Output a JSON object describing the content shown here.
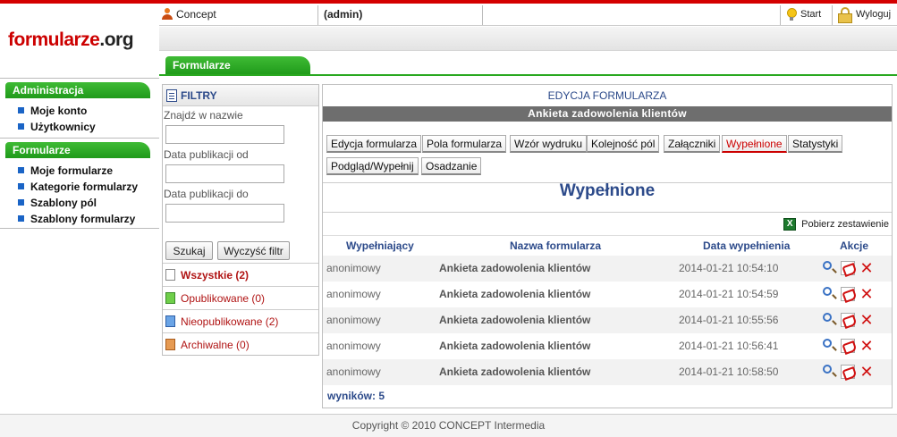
{
  "logo": {
    "part1": "formularze",
    "part2": ".org"
  },
  "topbar": {
    "user": "Concept",
    "role": "(admin)",
    "start": "Start",
    "logout": "Wyloguj"
  },
  "main_tab": "Formularze",
  "sidebar": {
    "sections": [
      {
        "title": "Administracja",
        "items": [
          "Moje konto",
          "Użytkownicy"
        ]
      },
      {
        "title": "Formularze",
        "items": [
          "Moje formularze",
          "Kategorie formularzy",
          "Szablony pól",
          "Szablony formularzy"
        ]
      }
    ]
  },
  "filters": {
    "title": "FILTRY",
    "name_label": "Znajdź w nazwie",
    "date_from_label": "Data publikacji od",
    "date_to_label": "Data publikacji do",
    "name_value": "",
    "date_from_value": "",
    "date_to_value": "",
    "search_button": "Szukaj",
    "clear_button": "Wyczyść filtr",
    "items": [
      "Wszystkie (2)",
      "Opublikowane (0)",
      "Nieopublikowane (2)",
      "Archiwalne (0)"
    ]
  },
  "main": {
    "title": "EDYCJA FORMULARZA",
    "subtitle": "Ankieta zadowolenia klientów",
    "tabs": [
      "Edycja formularza",
      "Pola formularza",
      "Wzór wydruku",
      "Kolejność pól",
      "Załączniki",
      "Wypełnione",
      "Statystyki",
      "Podgląd/Wypełnij",
      "Osadzanie"
    ],
    "active_tab": "Wypełnione",
    "heading": "Wypełnione",
    "download": "Pobierz zestawienie",
    "columns": [
      "Wypełniający",
      "Nazwa formularza",
      "Data wypełnienia",
      "Akcje"
    ],
    "rows": [
      {
        "user": "anonimowy",
        "form": "Ankieta zadowolenia klientów",
        "date": "2014-01-21 10:54:10"
      },
      {
        "user": "anonimowy",
        "form": "Ankieta zadowolenia klientów",
        "date": "2014-01-21 10:54:59"
      },
      {
        "user": "anonimowy",
        "form": "Ankieta zadowolenia klientów",
        "date": "2014-01-21 10:55:56"
      },
      {
        "user": "anonimowy",
        "form": "Ankieta zadowolenia klientów",
        "date": "2014-01-21 10:56:41"
      },
      {
        "user": "anonimowy",
        "form": "Ankieta zadowolenia klientów",
        "date": "2014-01-21 10:58:50"
      }
    ],
    "result_count": "wyników: 5"
  },
  "footer": "Copyright © 2010 CONCEPT Intermedia",
  "colors": {
    "accent_green": "#29a820",
    "brand_red": "#cc0000",
    "link_blue": "#2c4a8a"
  }
}
